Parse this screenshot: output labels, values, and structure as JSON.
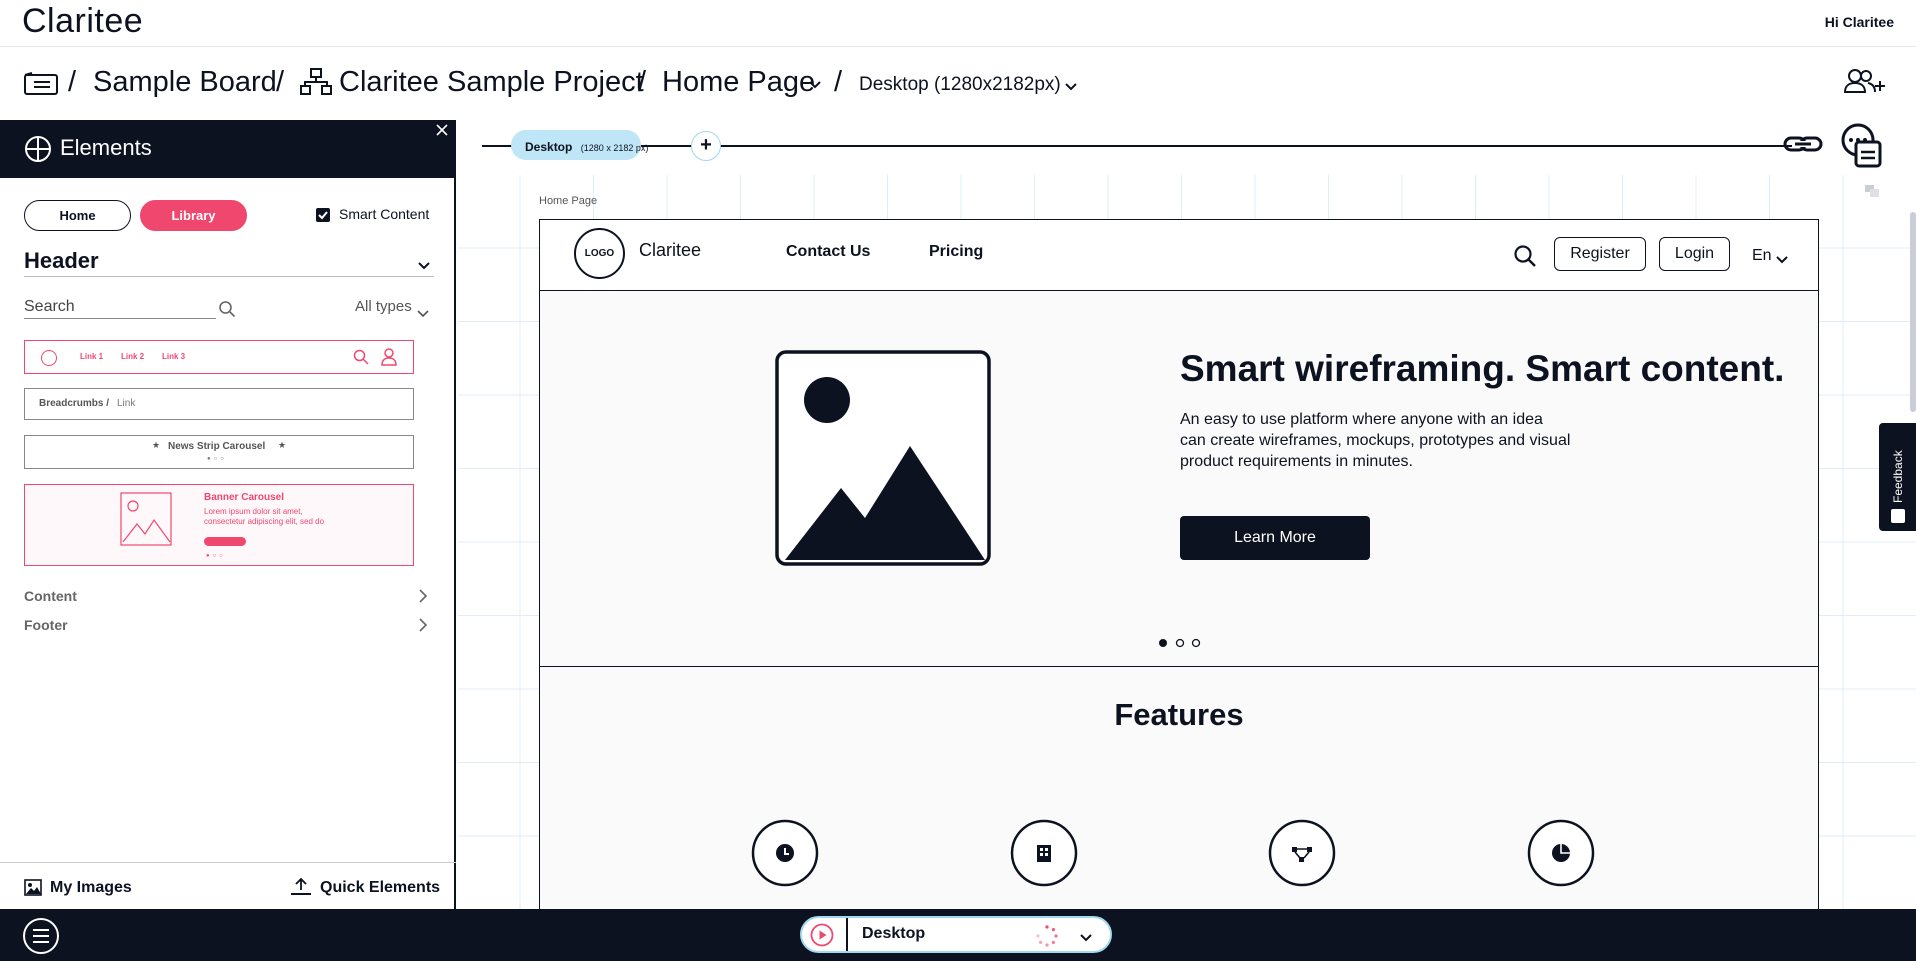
{
  "app": {
    "logo_text": "Claritee",
    "greeting": "Hi Claritee"
  },
  "breadcrumb": {
    "board": "Sample Board",
    "project": "Claritee Sample Project",
    "page": "Home Page",
    "device": "Desktop (1280x2182px)",
    "separator": "/"
  },
  "left_panel": {
    "title": "Elements",
    "tabs": {
      "home": "Home",
      "library": "Library"
    },
    "smart_content": {
      "label": "Smart Content",
      "checked": true
    },
    "section": "Header",
    "search_placeholder": "Search",
    "type_filter": "All types",
    "cards": {
      "nav_links": [
        "Link 1",
        "Link 2",
        "Link 3"
      ],
      "breadcrumbs_bold": "Breadcrumbs /",
      "breadcrumbs_link": "Link",
      "news_strip": "News Strip Carousel",
      "banner_title": "Banner Carousel",
      "banner_text": "Lorem ipsum dolor sit amet, consectetur adipiscing elit, sed do"
    },
    "categories": [
      "Content",
      "Footer"
    ],
    "bottom": {
      "my_images": "My Images",
      "quick_elements": "Quick Elements"
    }
  },
  "canvas": {
    "device_tab": "Desktop",
    "device_tab_size": "(1280 x 2182 px)",
    "add_label": "+",
    "page_label": "Home Page"
  },
  "wireframe": {
    "logo": "LOGO",
    "brand": "Claritee",
    "nav": [
      "Contact Us",
      "Pricing"
    ],
    "register": "Register",
    "login": "Login",
    "language": "En",
    "hero_title": "Smart wireframing. Smart content.",
    "hero_text": [
      "An easy to use platform where anyone with an idea",
      "can create wireframes, mockups, prototypes and visual",
      "product requirements in minutes."
    ],
    "hero_button": "Learn More",
    "features_title": "Features"
  },
  "bottom_bar": {
    "device": "Desktop"
  },
  "feedback": "Feedback",
  "colors": {
    "dark": "#0d1220",
    "accent": "#f0476f",
    "tab_blue": "#bfe6f7"
  }
}
